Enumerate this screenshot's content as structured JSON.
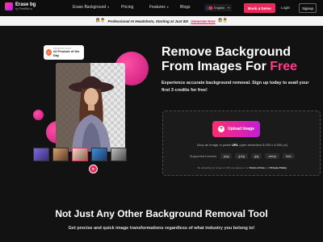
{
  "brand": {
    "name": "Erase bg",
    "sub": "by PixelBin.io"
  },
  "nav": {
    "items": [
      {
        "label": "Erase Background",
        "has_dropdown": true
      },
      {
        "label": "Pricing",
        "has_dropdown": false
      },
      {
        "label": "Features",
        "has_dropdown": true
      },
      {
        "label": "Blogs",
        "has_dropdown": false
      }
    ],
    "language": "English",
    "book_demo": "Book a Demo",
    "login": "Login",
    "signup": "Signup"
  },
  "promo": {
    "emoji_left": "👩‍💼👨‍💼",
    "text": "Professional AI Headshots, Starting at Just $5!",
    "link": "Generate Now",
    "emoji_right": "👩‍💼👨‍💼"
  },
  "award": {
    "sub": "PRODUCT HUNT",
    "main": "#2 Product of the Day"
  },
  "hero": {
    "title_line1": "Remove Background",
    "title_line2_prefix": "From Images For",
    "title_accent": "Free",
    "description": "Experience accurate background removal. Sign up today to avail your first 3 credits for free!"
  },
  "upload": {
    "button": "Upload Image",
    "drop_prefix": "Drop an image or paste",
    "drop_bold": "URL",
    "drop_suffix": "(upto resolution 5,000 x 5,000 px)",
    "formats_label": "Supported formats:",
    "formats": [
      "png",
      "jpeg",
      "jpg",
      "webp",
      "heic"
    ],
    "terms_prefix": "By uploading an image or URL you agree to our",
    "terms_link": "Terms of Use",
    "terms_and": "and",
    "privacy_link": "Privacy Policy."
  },
  "section": {
    "title": "Not Just Any Other Background Removal Tool",
    "subtitle": "Get precise and quick image transformations regardless of what industry you belong to!"
  },
  "colors": {
    "accent": "#ea2a5d",
    "pink": "#ff3d8b",
    "bg": "#121212"
  },
  "icons": {
    "cursor": "pointer-cursor-icon",
    "plus": "plus-icon",
    "medal": "medal-icon"
  }
}
